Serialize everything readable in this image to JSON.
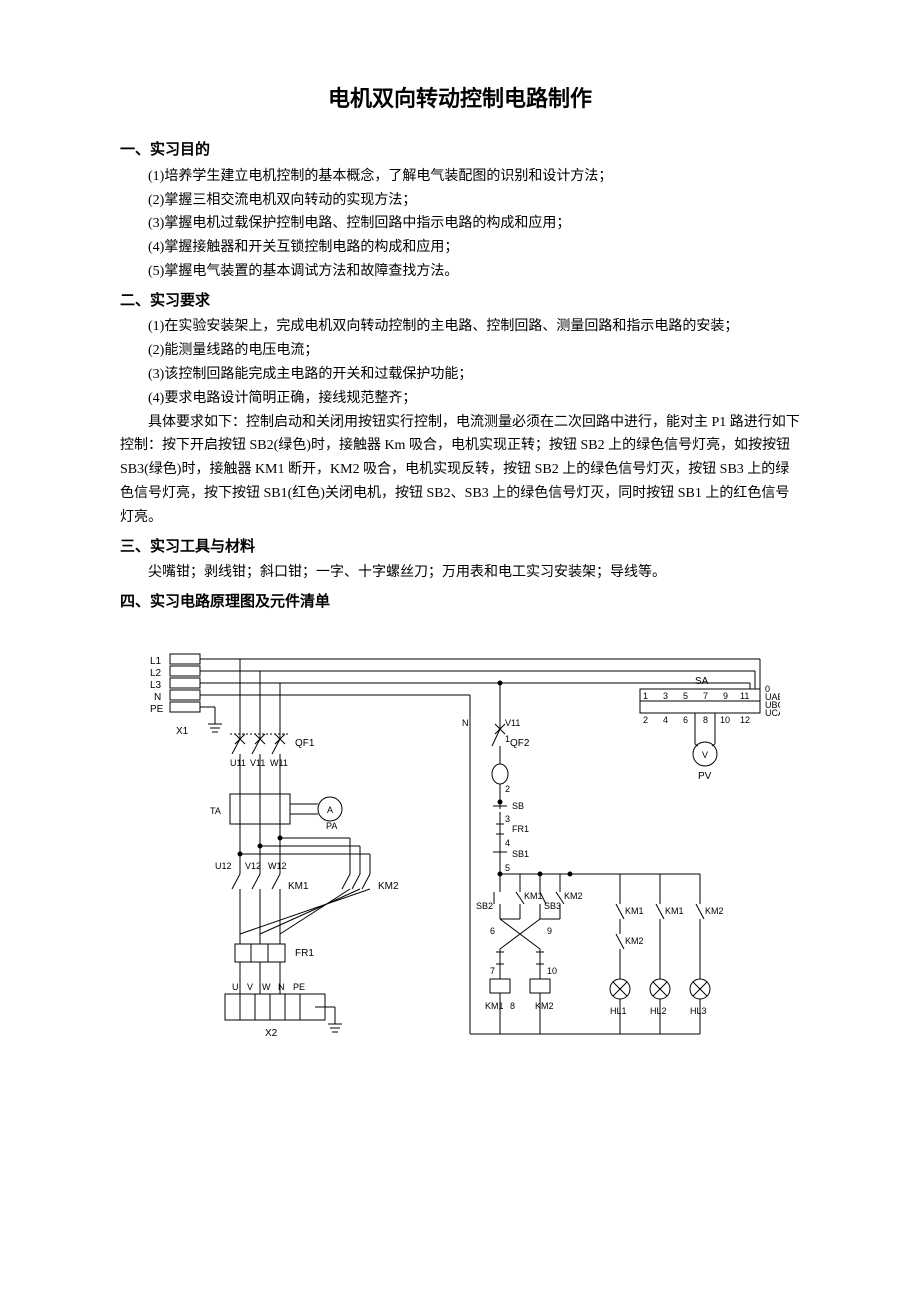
{
  "title": "电机双向转动控制电路制作",
  "section1": {
    "heading": "一、实习目的",
    "items": [
      "(1)培养学生建立电机控制的基本概念，了解电气装配图的识别和设计方法；",
      "(2)掌握三相交流电机双向转动的实现方法；",
      "(3)掌握电机过载保护控制电路、控制回路中指示电路的构成和应用；",
      "(4)掌握接触器和开关互锁控制电路的构成和应用；",
      "(5)掌握电气装置的基本调试方法和故障查找方法。"
    ]
  },
  "section2": {
    "heading": "二、实习要求",
    "items": [
      "(1)在实验安装架上，完成电机双向转动控制的主电路、控制回路、测量回路和指示电路的安装；",
      "(2)能测量线路的电压电流；",
      "(3)该控制回路能完成主电路的开关和过载保护功能；",
      "(4)要求电路设计简明正确，接线规范整齐；"
    ],
    "detail": "具体要求如下：控制启动和关闭用按钮实行控制，电流测量必须在二次回路中进行，能对主 P1 路进行如下控制：按下开启按钮 SB2(绿色)时，接触器 Km 吸合，电机实现正转；按钮 SB2 上的绿色信号灯亮，如按按钮 SB3(绿色)时，接触器 KM1 断开，KM2 吸合，电机实现反转，按钮 SB2 上的绿色信号灯灭，按钮 SB3 上的绿色信号灯亮，按下按钮 SB1(红色)关闭电机，按钮 SB2、SB3 上的绿色信号灯灭，同时按钮 SB1 上的红色信号灯亮。"
  },
  "section3": {
    "heading": "三、实习工具与材料",
    "text": "尖嘴钳；剥线钳；斜口钳；一字、十字螺丝刀；万用表和电工实习安装架；导线等。"
  },
  "section4": {
    "heading": "四、实习电路原理图及元件清单"
  },
  "diagram": {
    "L1": "L1",
    "L2": "L2",
    "L3": "L3",
    "N": "N",
    "PE": "PE",
    "X1": "X1",
    "X2": "X2",
    "QF1": "QF1",
    "QF2": "QF2",
    "U11": "U11",
    "V11": "V11",
    "W11": "W11",
    "U12": "U12",
    "V12": "V12",
    "W12": "W12",
    "TA": "TA",
    "A": "A",
    "PA": "PA",
    "KM1": "KM1",
    "KM2": "KM2",
    "FR1": "FR1",
    "U": "U",
    "V": "V",
    "W": "W",
    "Nb": "N",
    "PEb": "PE",
    "V11r": "V11",
    "SB": "SB",
    "SB1": "SB1",
    "SB2": "SB2",
    "SB3": "SB3",
    "HL1": "HL1",
    "HL2": "HL2",
    "HL3": "HL3",
    "SA": "SA",
    "PV": "PV",
    "Vsym": "V",
    "UAB": "UAB",
    "UBC": "UBC",
    "UCA": "UCA",
    "zero": "0",
    "n1": "1",
    "n2": "2",
    "n3": "3",
    "n4": "4",
    "n5": "5",
    "n6": "6",
    "n7": "7",
    "n8": "8",
    "n9": "9",
    "n10": "10",
    "n11": "11",
    "n12": "12"
  }
}
